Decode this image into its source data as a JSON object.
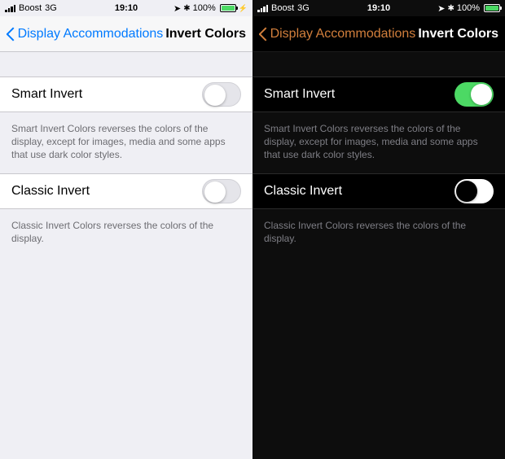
{
  "status": {
    "carrier": "Boost",
    "network": "3G",
    "time": "19:10",
    "battery_pct": "100%"
  },
  "nav": {
    "back_label": "Display Accommodations",
    "title": "Invert Colors"
  },
  "rows": {
    "smart": {
      "label": "Smart Invert",
      "footer": "Smart Invert Colors reverses the colors of the display, except for images, media and some apps that use dark color styles."
    },
    "classic": {
      "label": "Classic Invert",
      "footer": "Classic Invert Colors reverses the colors of the display."
    }
  }
}
